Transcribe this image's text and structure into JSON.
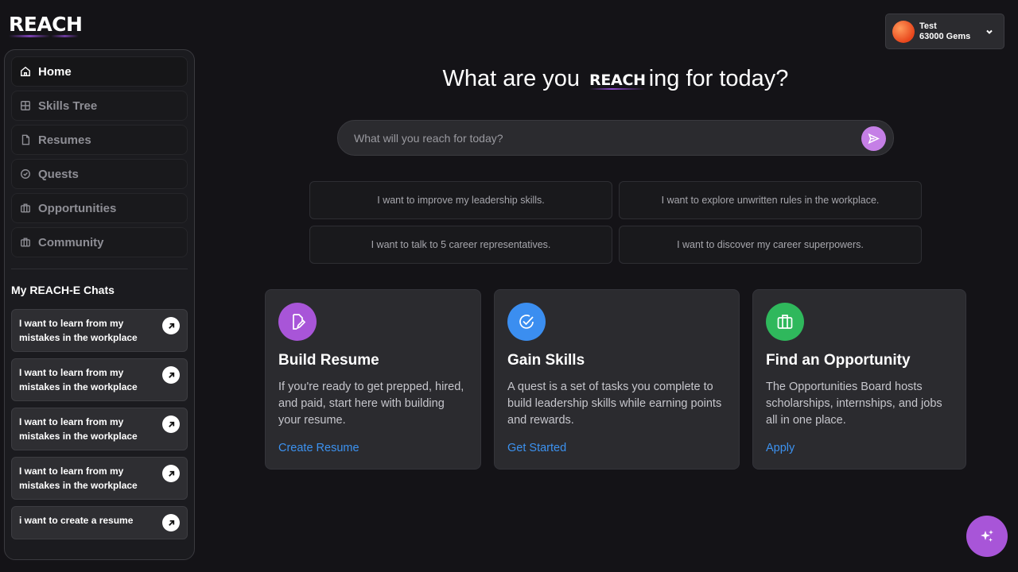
{
  "brand": {
    "logo": "REACH",
    "logo_mini": "REACH"
  },
  "user": {
    "name": "Test",
    "gems": "63000 Gems"
  },
  "sidebar": {
    "items": [
      {
        "label": "Home",
        "icon": "home-icon",
        "active": true
      },
      {
        "label": "Skills Tree",
        "icon": "grid-icon"
      },
      {
        "label": "Resumes",
        "icon": "file-icon"
      },
      {
        "label": "Quests",
        "icon": "check-circle-icon"
      },
      {
        "label": "Opportunities",
        "icon": "briefcase-icon"
      },
      {
        "label": "Community",
        "icon": "briefcase-icon"
      }
    ],
    "chats_title": "My REACH-E Chats",
    "chats": [
      "I want to learn from my mistakes in the workplace",
      "I want to learn from my mistakes in the workplace",
      "I want to learn from my mistakes in the workplace",
      "I want to learn from my mistakes in the workplace",
      "i want to create a resume"
    ]
  },
  "main": {
    "headline_before": "What are you",
    "headline_after": "ing for today?",
    "search_placeholder": "What will you reach for today?",
    "suggestions": [
      "I want to improve my leadership skills.",
      "I want to explore unwritten rules in the workplace.",
      "I want to talk to 5 career representatives.",
      "I want to discover my career superpowers."
    ],
    "cards": [
      {
        "title": "Build Resume",
        "description": "If you're ready to get prepped, hired, and paid, start here with building your resume.",
        "link": "Create Resume",
        "icon": "resume-edit-icon",
        "color": "#a855d8"
      },
      {
        "title": "Gain Skills",
        "description": "A quest is a set of tasks you complete to build leadership skills while earning points and rewards.",
        "link": "Get Started",
        "icon": "check-circle-icon",
        "color": "#3b8ef0"
      },
      {
        "title": "Find an Opportunity",
        "description": "The Opportunities Board hosts scholarships, internships, and jobs all in one place.",
        "link": "Apply",
        "icon": "briefcase-icon",
        "color": "#2fb85c"
      }
    ]
  },
  "colors": {
    "background": "#141317",
    "accent": "#a855d8",
    "link": "#3c92f0"
  }
}
